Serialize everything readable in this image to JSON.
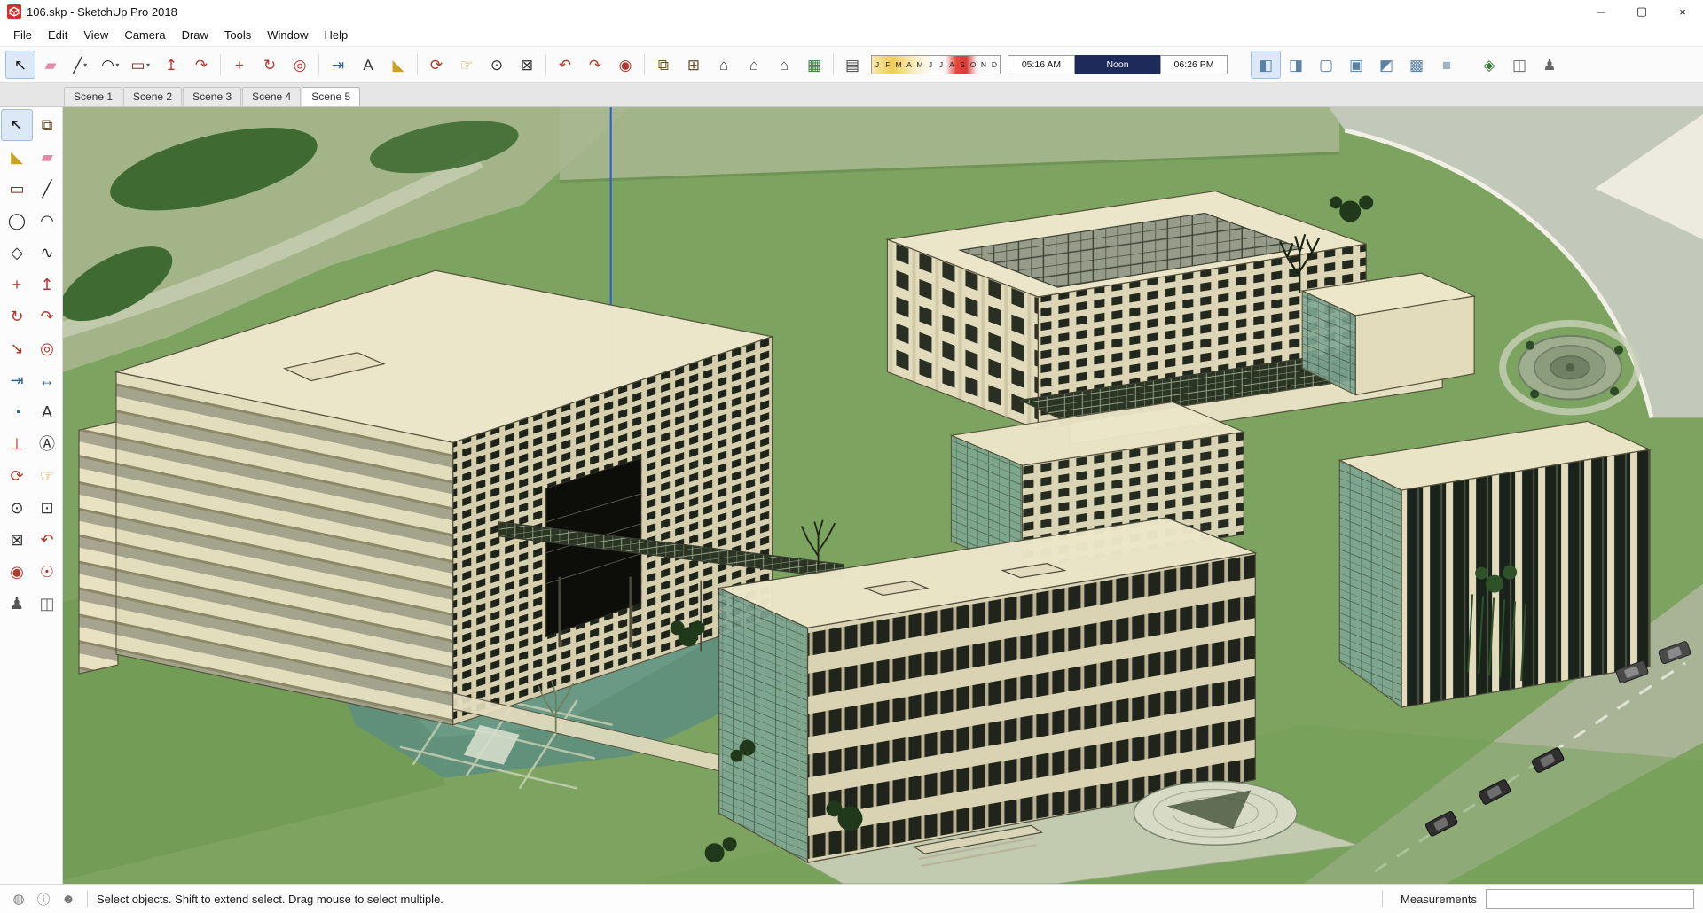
{
  "window": {
    "title": "106.skp - SketchUp Pro 2018",
    "controls": {
      "minimize": "─",
      "maximize": "▢",
      "close": "×"
    }
  },
  "menu": {
    "items": [
      {
        "label": "File"
      },
      {
        "label": "Edit"
      },
      {
        "label": "View"
      },
      {
        "label": "Camera"
      },
      {
        "label": "Draw"
      },
      {
        "label": "Tools"
      },
      {
        "label": "Window"
      },
      {
        "label": "Help"
      }
    ]
  },
  "toolbar": {
    "icons": [
      {
        "name": "select-tool-button",
        "glyph": "↖",
        "color": "#1a1a1a",
        "caret": "",
        "_class": "active"
      },
      {
        "name": "eraser-tool-button",
        "glyph": "▰",
        "color": "#e08aa8",
        "caret": ""
      },
      {
        "name": "line-tool-button",
        "glyph": "╱",
        "color": "#2b2b2b",
        "caret": "▾"
      },
      {
        "name": "arc-tool-button",
        "glyph": "◠",
        "color": "#2b2b2b",
        "caret": "▾"
      },
      {
        "name": "rectangle-tool-button",
        "glyph": "▭",
        "color": "#7a2d23",
        "caret": "▾"
      },
      {
        "name": "push-pull-tool-button",
        "glyph": "↥",
        "color": "#b03a2e",
        "caret": ""
      },
      {
        "name": "follow-me-tool-button",
        "glyph": "↷",
        "color": "#b03a2e",
        "caret": ""
      },
      {
        "name": "toolbar-separator",
        "glyph": "",
        "caret": "",
        "_class": "sep",
        "_inter": "false"
      },
      {
        "name": "move-tool-button",
        "glyph": "+",
        "color": "#b03a2e",
        "caret": ""
      },
      {
        "name": "rotate-tool-button",
        "glyph": "↻",
        "color": "#b03a2e",
        "caret": ""
      },
      {
        "name": "offset-tool-button",
        "glyph": "◎",
        "color": "#b03a2e",
        "caret": ""
      },
      {
        "name": "toolbar-separator",
        "glyph": "",
        "caret": "",
        "_class": "sep",
        "_inter": "false"
      },
      {
        "name": "tape-measure-tool-button",
        "glyph": "⇥",
        "color": "#2f5f8f",
        "caret": ""
      },
      {
        "name": "text-tool-button",
        "glyph": "A",
        "color": "#333333",
        "caret": ""
      },
      {
        "name": "paint-bucket-tool-button",
        "glyph": "◣",
        "color": "#c9a227",
        "caret": ""
      },
      {
        "name": "toolbar-separator",
        "glyph": "",
        "caret": "",
        "_class": "sep",
        "_inter": "false"
      },
      {
        "name": "orbit-tool-button",
        "glyph": "⟳",
        "color": "#b03a2e",
        "caret": ""
      },
      {
        "name": "pan-tool-button",
        "glyph": "☞",
        "color": "#c9a227",
        "caret": ""
      },
      {
        "name": "zoom-tool-button",
        "glyph": "⊙",
        "color": "#333333",
        "caret": ""
      },
      {
        "name": "zoom-extents-button",
        "glyph": "⊠",
        "color": "#333333",
        "caret": ""
      },
      {
        "name": "toolbar-separator",
        "glyph": "",
        "caret": "",
        "_class": "sep",
        "_inter": "false"
      },
      {
        "name": "previous-view-button",
        "glyph": "↶",
        "color": "#b03a2e",
        "caret": ""
      },
      {
        "name": "next-view-button",
        "glyph": "↷",
        "color": "#b03a2e",
        "caret": ""
      },
      {
        "name": "position-camera-button",
        "glyph": "◉",
        "color": "#b03a2e",
        "caret": ""
      },
      {
        "name": "toolbar-separator",
        "glyph": "",
        "caret": "",
        "_class": "sep",
        "_inter": "false"
      },
      {
        "name": "make-component-button",
        "glyph": "⧉",
        "color": "#6b4f2a",
        "caret": ""
      },
      {
        "name": "components-panel-button",
        "glyph": "⊞",
        "color": "#6b4f2a",
        "caret": ""
      },
      {
        "name": "get-models-button",
        "glyph": "⌂",
        "color": "#444444",
        "caret": ""
      },
      {
        "name": "share-model-button",
        "glyph": "⌂",
        "color": "#444444",
        "caret": ""
      },
      {
        "name": "share-component-button",
        "glyph": "⌂",
        "color": "#444444",
        "caret": ""
      },
      {
        "name": "extension-warehouse-button",
        "glyph": "▦",
        "color": "#3a7a3a",
        "caret": ""
      },
      {
        "name": "toolbar-separator",
        "glyph": "",
        "caret": "",
        "_class": "sep",
        "_inter": "false"
      },
      {
        "name": "shadow-settings-button",
        "glyph": "▤",
        "color": "#444444",
        "caret": ""
      }
    ],
    "shadows": {
      "months": [
        "J",
        "F",
        "M",
        "A",
        "M",
        "J",
        "J",
        "A",
        "S",
        "O",
        "N",
        "D"
      ],
      "sunrise": "05:16 AM",
      "noon": "Noon",
      "sunset": "06:26 PM"
    },
    "style_icons": [
      {
        "name": "style-xray-button",
        "glyph": "◧",
        "color": "#5b82a6",
        "_class": "active"
      },
      {
        "name": "style-back-edges-button",
        "glyph": "◨",
        "color": "#5b82a6"
      },
      {
        "name": "style-wireframe-button",
        "glyph": "▢",
        "color": "#5b82a6"
      },
      {
        "name": "style-hidden-line-button",
        "glyph": "▣",
        "color": "#5b82a6"
      },
      {
        "name": "style-shaded-button",
        "glyph": "◩",
        "color": "#5b82a6"
      },
      {
        "name": "style-shaded-textures-button",
        "glyph": "▩",
        "color": "#5b82a6"
      },
      {
        "name": "style-monochrome-button",
        "glyph": "■",
        "color": "#9fb3c4"
      }
    ],
    "right_icons": [
      {
        "name": "add-location-button",
        "glyph": "◈",
        "color": "#3a7a3a"
      },
      {
        "name": "section-plane-button",
        "glyph": "◫",
        "color": "#666666"
      },
      {
        "name": "walk-tool-button",
        "glyph": "♟",
        "color": "#666666"
      }
    ]
  },
  "scene_tabs": {
    "tabs": [
      {
        "name": "scene-tab-1",
        "label": "Scene 1"
      },
      {
        "name": "scene-tab-2",
        "label": "Scene 2"
      },
      {
        "name": "scene-tab-3",
        "label": "Scene 3"
      },
      {
        "name": "scene-tab-4",
        "label": "Scene 4"
      },
      {
        "name": "scene-tab-5",
        "label": "Scene 5",
        "_class": "active"
      }
    ]
  },
  "left_toolbar": {
    "tools": [
      {
        "name": "select-tool",
        "glyph": "↖",
        "color": "#1a1a1a",
        "_class": "active"
      },
      {
        "name": "make-component-tool",
        "glyph": "⧉",
        "color": "#6b4f2a"
      },
      {
        "name": "paint-bucket-tool",
        "glyph": "◣",
        "color": "#c9a227"
      },
      {
        "name": "eraser-tool",
        "glyph": "▰",
        "color": "#e08aa8"
      },
      {
        "name": "rectangle-tool",
        "glyph": "▭",
        "color": "#7a2d23"
      },
      {
        "name": "line-tool",
        "glyph": "╱",
        "color": "#2b2b2b"
      },
      {
        "name": "circle-tool",
        "glyph": "◯",
        "color": "#2b2b2b"
      },
      {
        "name": "arc-tool",
        "glyph": "◠",
        "color": "#2b2b2b"
      },
      {
        "name": "polygon-tool",
        "glyph": "◇",
        "color": "#2b2b2b"
      },
      {
        "name": "freehand-tool",
        "glyph": "∿",
        "color": "#2b2b2b"
      },
      {
        "name": "move-tool",
        "glyph": "+",
        "color": "#b03a2e"
      },
      {
        "name": "push-pull-tool",
        "glyph": "↥",
        "color": "#b03a2e"
      },
      {
        "name": "rotate-tool",
        "glyph": "↻",
        "color": "#b03a2e"
      },
      {
        "name": "follow-me-tool",
        "glyph": "↷",
        "color": "#b03a2e"
      },
      {
        "name": "scale-tool",
        "glyph": "↘",
        "color": "#b03a2e"
      },
      {
        "name": "offset-tool",
        "glyph": "◎",
        "color": "#b03a2e"
      },
      {
        "name": "tape-measure-tool",
        "glyph": "⇥",
        "color": "#2f5f8f"
      },
      {
        "name": "dimension-tool",
        "glyph": "↔",
        "color": "#2f5f8f"
      },
      {
        "name": "protractor-tool",
        "glyph": "◔",
        "color": "#2f5f8f"
      },
      {
        "name": "text-tool",
        "glyph": "A",
        "color": "#333333"
      },
      {
        "name": "axes-tool",
        "glyph": "⊥",
        "color": "#b03a2e"
      },
      {
        "name": "3d-text-tool",
        "glyph": "Ⓐ",
        "color": "#333333"
      },
      {
        "name": "orbit-tool",
        "glyph": "⟳",
        "color": "#b03a2e"
      },
      {
        "name": "pan-tool",
        "glyph": "☞",
        "color": "#c9a227"
      },
      {
        "name": "zoom-tool",
        "glyph": "⊙",
        "color": "#333333"
      },
      {
        "name": "zoom-window-tool",
        "glyph": "⊡",
        "color": "#333333"
      },
      {
        "name": "zoom-extents-tool",
        "glyph": "⊠",
        "color": "#333333"
      },
      {
        "name": "previous-view-tool",
        "glyph": "↶",
        "color": "#b03a2e"
      },
      {
        "name": "position-camera-tool",
        "glyph": "◉",
        "color": "#b03a2e"
      },
      {
        "name": "look-around-tool",
        "glyph": "☉",
        "color": "#b03a2e"
      },
      {
        "name": "walk-tool",
        "glyph": "♟",
        "color": "#555555"
      },
      {
        "name": "section-plane-tool",
        "glyph": "◫",
        "color": "#666666"
      }
    ]
  },
  "viewport": {
    "scene_colors": {
      "terrain": "#7CA360",
      "building": "#EFE9CD",
      "water": "#5E8F7D",
      "glass": "#7FA794",
      "axis_blue": "#2B5BD7"
    }
  },
  "statusbar": {
    "hint": "Select objects. Shift to extend select. Drag mouse to select multiple.",
    "measurements_label": "Measurements",
    "measurements_value": ""
  }
}
